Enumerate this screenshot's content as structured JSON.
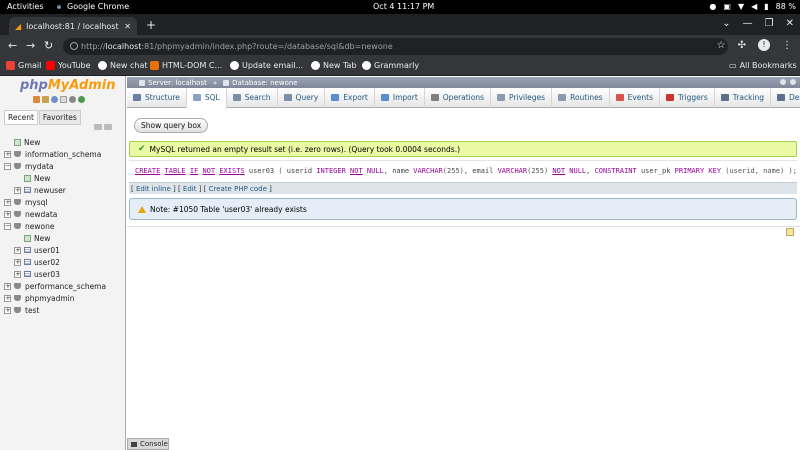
{
  "os": {
    "activities": "Activities",
    "app_name": "Google Chrome",
    "clock": "Oct 4  11:17 PM",
    "battery": "88 %"
  },
  "browser": {
    "tab_title": "localhost:81 / localhost",
    "url_prefix": "http://",
    "url_host": "localhost",
    "url_rest": ":81/phpmyadmin/index.php?route=/database/sql&db=newone",
    "profile_initial": "!",
    "bookmarks": [
      {
        "label": "Gmail",
        "color": "#ea4335"
      },
      {
        "label": "YouTube",
        "color": "#ff0000"
      },
      {
        "label": "New chat",
        "color": "#ffffff"
      },
      {
        "label": "HTML-DOM C...",
        "color": "#e8710a"
      },
      {
        "label": "Update email...",
        "color": "#ffffff"
      },
      {
        "label": "New Tab",
        "color": "#ffffff"
      },
      {
        "label": "Grammarly",
        "color": "#ffffff"
      }
    ],
    "all_bookmarks": "All Bookmarks"
  },
  "sidebar": {
    "logo_php": "php",
    "logo_my": "MyAdmin",
    "tabs": [
      "Recent",
      "Favorites"
    ],
    "tree": [
      {
        "label": "New",
        "type": "new",
        "indent": 1
      },
      {
        "label": "information_schema",
        "type": "db",
        "indent": 0
      },
      {
        "label": "mydata",
        "type": "db",
        "indent": 0
      },
      {
        "label": "New",
        "type": "new",
        "indent": 2
      },
      {
        "label": "newuser",
        "type": "table",
        "indent": 1
      },
      {
        "label": "mysql",
        "type": "db",
        "indent": 0
      },
      {
        "label": "newdata",
        "type": "db",
        "indent": 0
      },
      {
        "label": "newone",
        "type": "db",
        "indent": 0
      },
      {
        "label": "New",
        "type": "new",
        "indent": 2
      },
      {
        "label": "user01",
        "type": "table",
        "indent": 1
      },
      {
        "label": "user02",
        "type": "table",
        "indent": 1
      },
      {
        "label": "user03",
        "type": "table",
        "indent": 1
      },
      {
        "label": "performance_schema",
        "type": "db",
        "indent": 0
      },
      {
        "label": "phpmyadmin",
        "type": "db",
        "indent": 0
      },
      {
        "label": "test",
        "type": "db",
        "indent": 0
      }
    ]
  },
  "breadcrumb": {
    "server": "Server: localhost",
    "database": "Database: newone"
  },
  "menu": [
    {
      "label": "Structure",
      "color": "#6b7fa6"
    },
    {
      "label": "SQL",
      "color": "#8aa0c8"
    },
    {
      "label": "Search",
      "color": "#7a8fa8"
    },
    {
      "label": "Query",
      "color": "#7a8fa8"
    },
    {
      "label": "Export",
      "color": "#5b8bd0"
    },
    {
      "label": "Import",
      "color": "#5b8bd0"
    },
    {
      "label": "Operations",
      "color": "#808080"
    },
    {
      "label": "Privileges",
      "color": "#8a9ab0"
    },
    {
      "label": "Routines",
      "color": "#8a9ab0"
    },
    {
      "label": "Events",
      "color": "#d9534f"
    },
    {
      "label": "Triggers",
      "color": "#cc3333"
    },
    {
      "label": "Tracking",
      "color": "#5b6f8a"
    },
    {
      "label": "Designer",
      "color": "#5b6f8a"
    }
  ],
  "main": {
    "show_query_box": "Show query box",
    "success_message": "MySQL returned an empty result set (i.e. zero rows). (Query took 0.0004 seconds.)",
    "sql_links": {
      "edit_inline": "Edit inline",
      "edit": "Edit",
      "create_php": "Create PHP code"
    },
    "note": "Note: #1050 Table 'user03' already exists",
    "console": "Console"
  }
}
